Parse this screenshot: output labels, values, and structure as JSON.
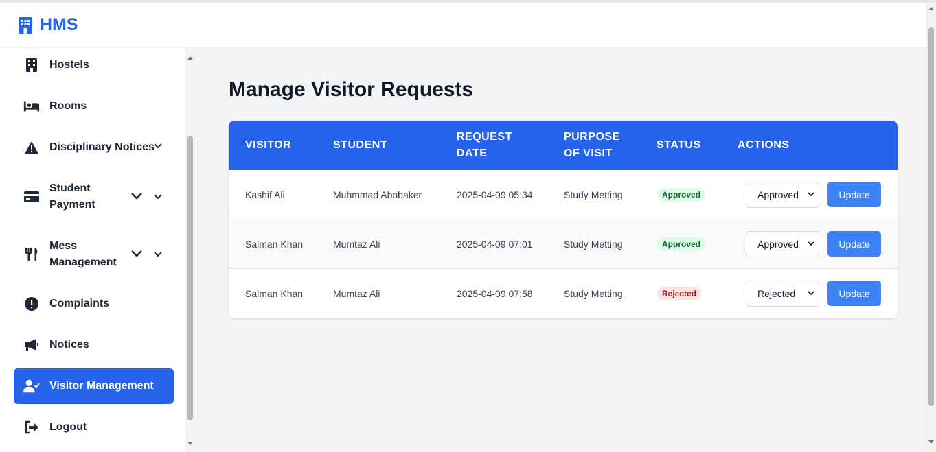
{
  "app": {
    "name": "HMS"
  },
  "sidebar": {
    "items": [
      {
        "label": "Hostels",
        "icon": "building-icon",
        "has_dropdown": false,
        "active": false
      },
      {
        "label": "Rooms",
        "icon": "bed-icon",
        "has_dropdown": false,
        "active": false
      },
      {
        "label": "Disciplinary Notices",
        "icon": "warning-icon",
        "has_dropdown": true,
        "active": false
      },
      {
        "label_lines": [
          "Student",
          "Payment"
        ],
        "icon": "credit-card-icon",
        "has_dropdown": true,
        "active": false
      },
      {
        "label_lines": [
          "Mess",
          "Management"
        ],
        "icon": "utensils-icon",
        "has_dropdown": true,
        "active": false
      },
      {
        "label": "Complaints",
        "icon": "exclamation-circle-icon",
        "has_dropdown": false,
        "active": false
      },
      {
        "label": "Notices",
        "icon": "megaphone-icon",
        "has_dropdown": false,
        "active": false
      },
      {
        "label": "Visitor Management",
        "icon": "user-check-icon",
        "has_dropdown": false,
        "active": true
      },
      {
        "label": "Logout",
        "icon": "logout-icon",
        "has_dropdown": false,
        "active": false
      }
    ]
  },
  "main": {
    "title": "Manage Visitor Requests",
    "table": {
      "headers": [
        {
          "lines": [
            "VISITOR"
          ]
        },
        {
          "lines": [
            "STUDENT"
          ]
        },
        {
          "lines": [
            "REQUEST",
            "DATE"
          ]
        },
        {
          "lines": [
            "PURPOSE",
            "OF VISIT"
          ]
        },
        {
          "lines": [
            "STATUS"
          ]
        },
        {
          "lines": [
            "ACTIONS"
          ]
        }
      ],
      "rows": [
        {
          "visitor": "Kashif Ali",
          "student": "Muhmmad Abobaker",
          "request_date": "2025-04-09 05:34",
          "purpose": "Study Metting",
          "status": "Approved",
          "select_value": "Approved",
          "button": "Update"
        },
        {
          "visitor": "Salman Khan",
          "student": "Mumtaz Ali",
          "request_date": "2025-04-09 07:01",
          "purpose": "Study Metting",
          "status": "Approved",
          "select_value": "Approved",
          "button": "Update"
        },
        {
          "visitor": "Salman Khan",
          "student": "Mumtaz Ali",
          "request_date": "2025-04-09 07:58",
          "purpose": "Study Metting",
          "status": "Rejected",
          "select_value": "Rejected",
          "button": "Update"
        }
      ]
    }
  },
  "colors": {
    "primary": "#2563eb",
    "button": "#3b82f6",
    "approved_bg": "#dcfce7",
    "approved_text": "#166534",
    "rejected_bg": "#fee2e2",
    "rejected_text": "#991b1b",
    "main_bg": "#f3f4f6"
  }
}
